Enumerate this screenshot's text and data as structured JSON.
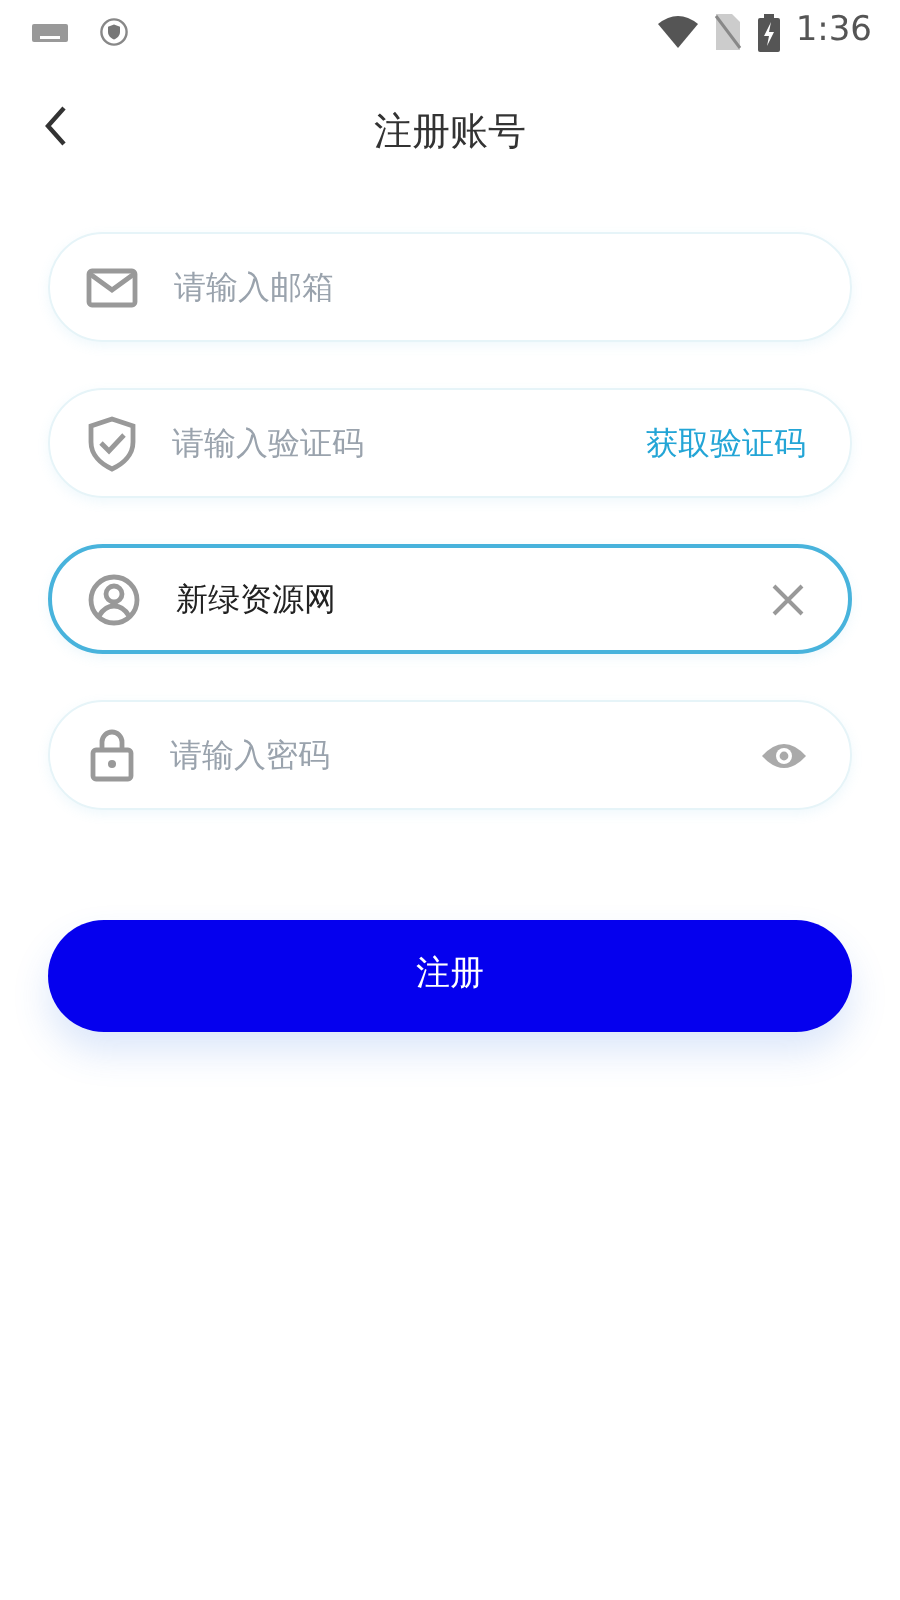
{
  "status_bar": {
    "time": "1:36"
  },
  "header": {
    "title": "注册账号"
  },
  "fields": [
    {
      "kind": "email",
      "placeholder": "请输入邮箱",
      "focused": false
    },
    {
      "kind": "code",
      "placeholder": "请输入验证码",
      "focused": false,
      "action": {
        "kind": "link",
        "label": "获取验证码"
      }
    },
    {
      "kind": "user",
      "value": "新绿资源网",
      "focused": true,
      "action": {
        "kind": "clear"
      }
    },
    {
      "kind": "password",
      "placeholder": "请输入密码",
      "focused": false,
      "action": {
        "kind": "reveal"
      }
    }
  ],
  "submit": {
    "label": "注册"
  }
}
